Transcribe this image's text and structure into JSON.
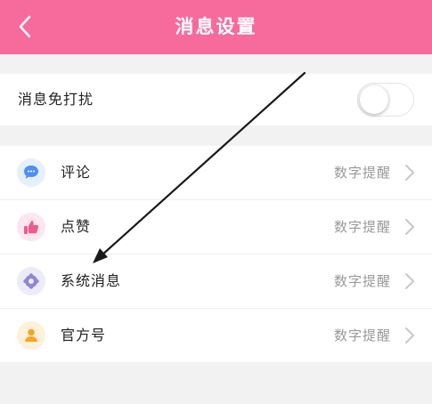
{
  "header": {
    "title": "消息设置",
    "back_icon": "chevron-left-icon"
  },
  "dnd": {
    "label": "消息免打扰",
    "enabled": false
  },
  "list": [
    {
      "label": "评论",
      "value": "数字提醒",
      "icon": "comment-icon",
      "icon_color": "#4f8ef7"
    },
    {
      "label": "点赞",
      "value": "数字提醒",
      "icon": "thumbs-up-icon",
      "icon_color": "#f05a8c"
    },
    {
      "label": "系统消息",
      "value": "数字提醒",
      "icon": "gear-icon",
      "icon_color": "#8f86d8"
    },
    {
      "label": "官方号",
      "value": "数字提醒",
      "icon": "user-icon",
      "icon_color": "#f5a623"
    }
  ],
  "colors": {
    "accent": "#f76b9c",
    "background": "#f2f2f2"
  }
}
